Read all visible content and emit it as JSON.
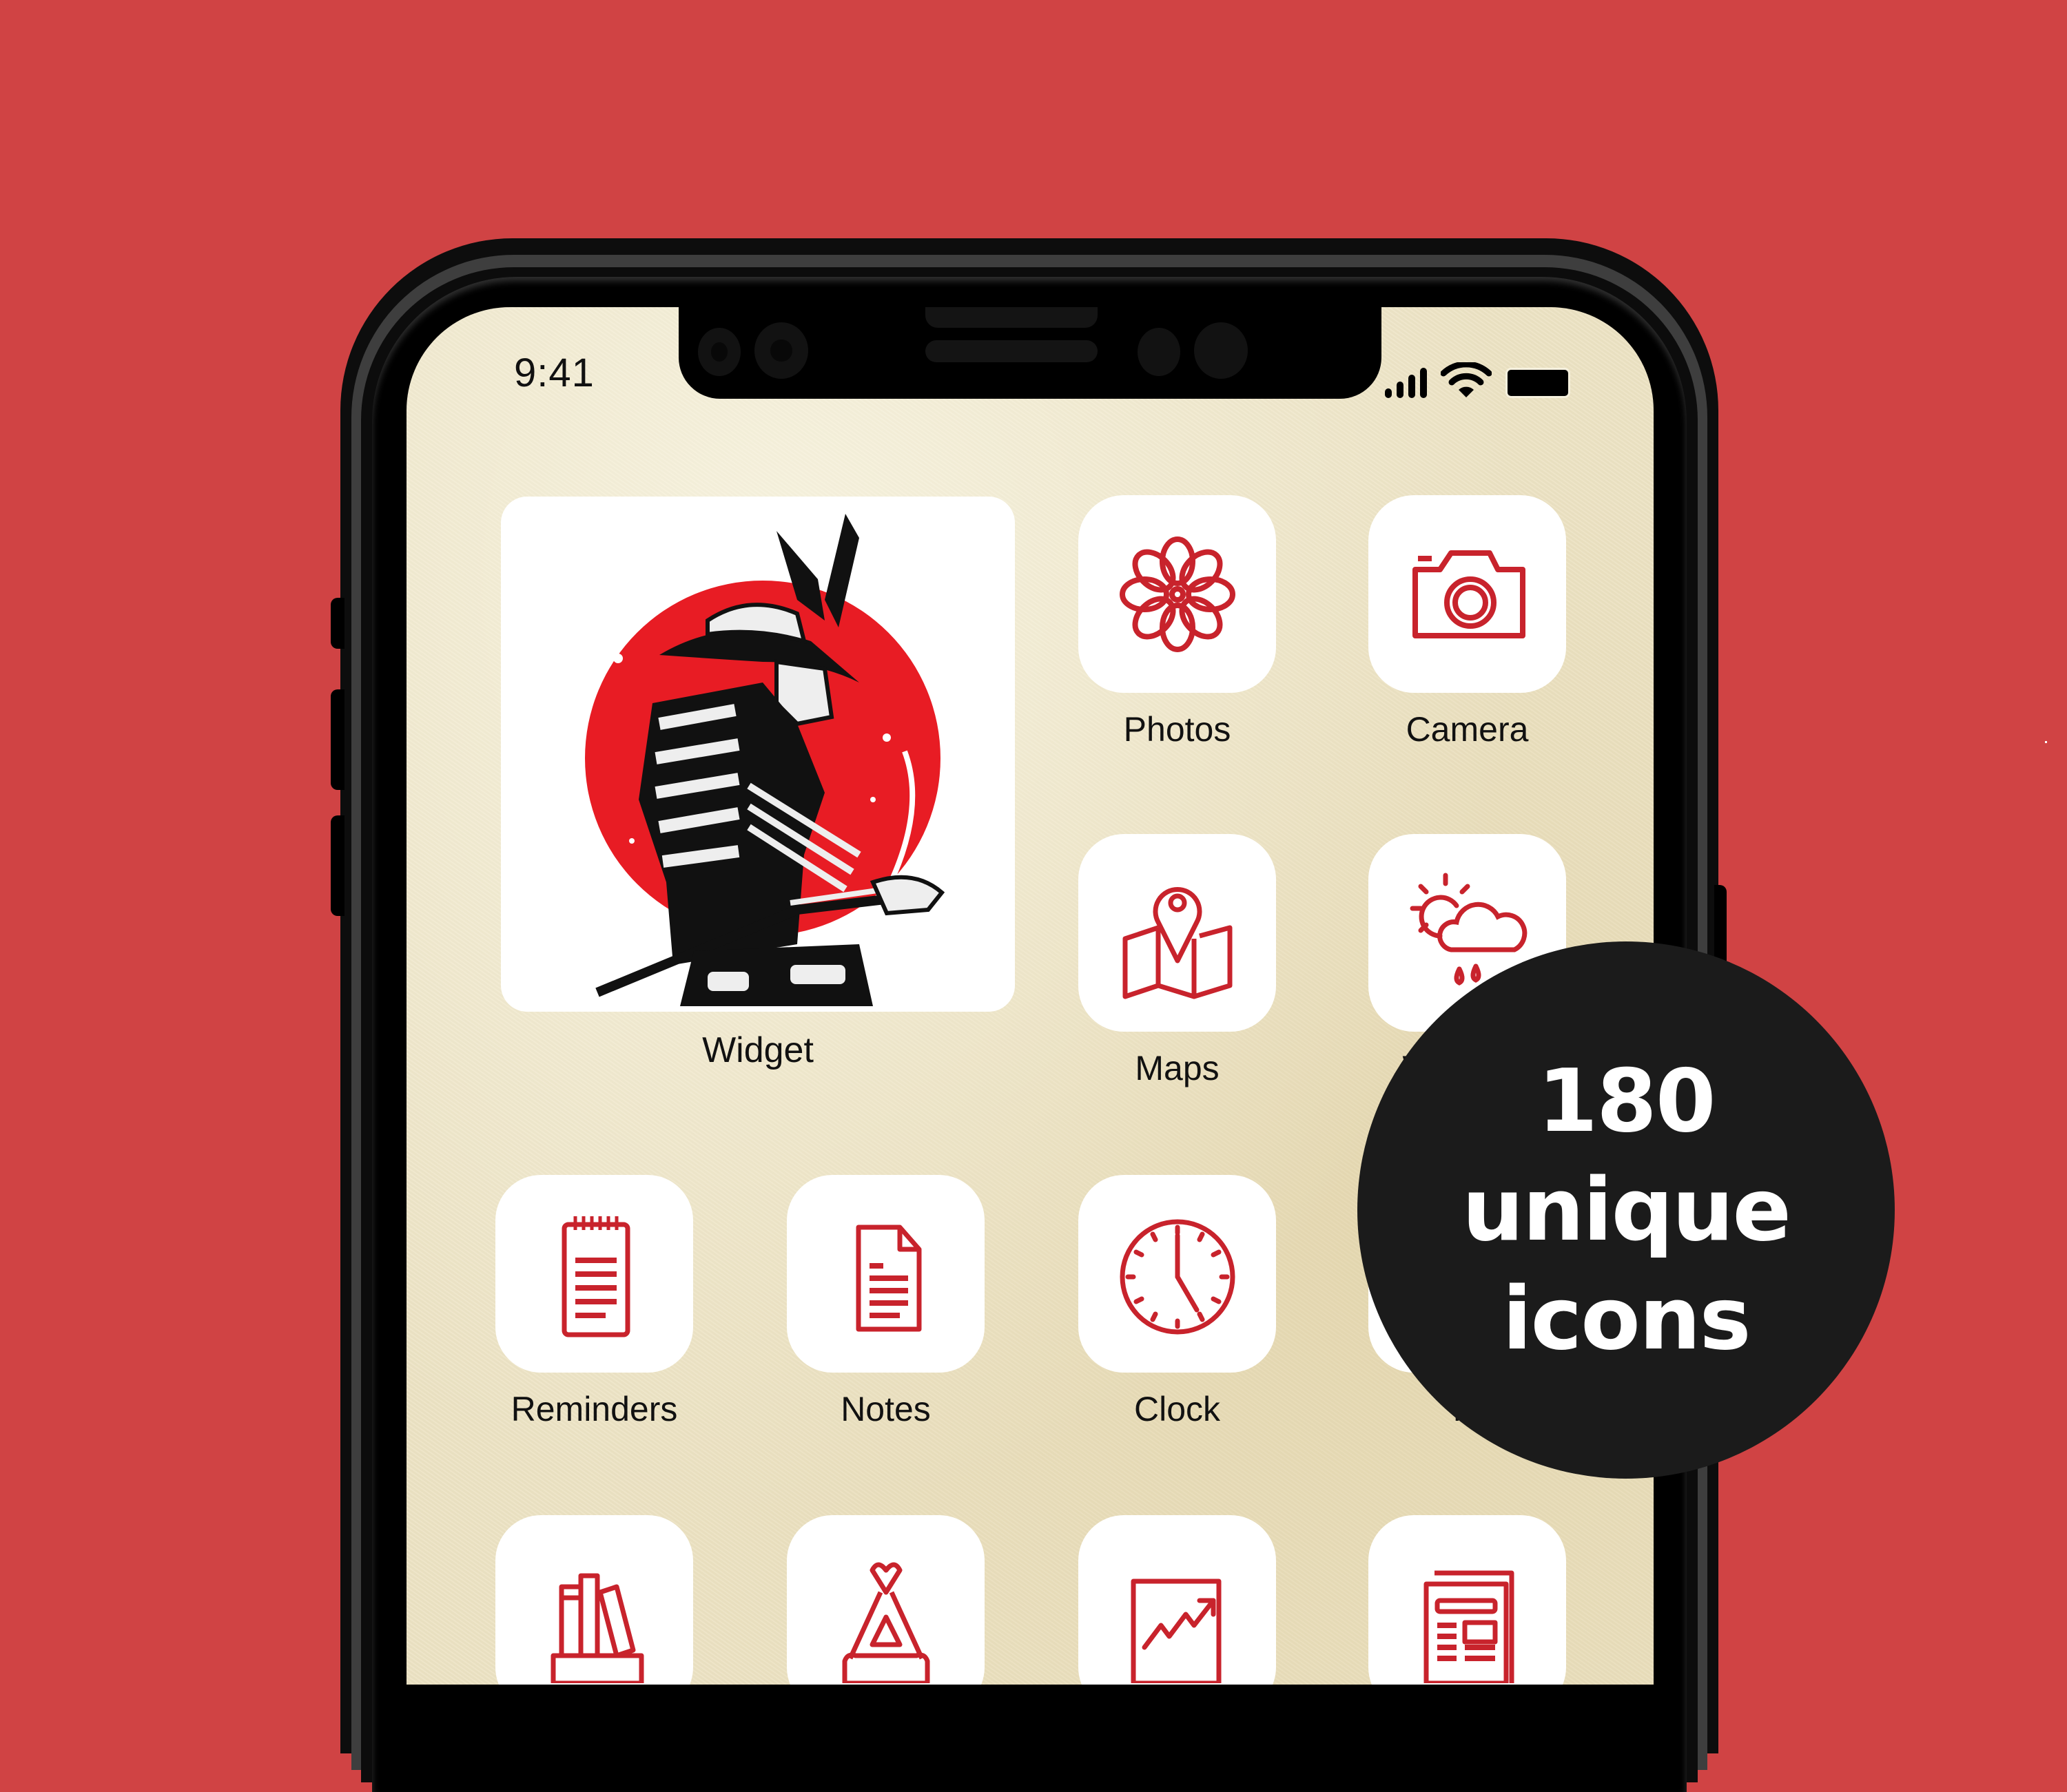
{
  "background_color": "#d04344",
  "accent_color": "#c8232c",
  "status_bar": {
    "time": "9:41",
    "icons": [
      "cellular-signal-icon",
      "wifi-icon",
      "battery-icon"
    ]
  },
  "widget": {
    "label": "Widget",
    "image": "samurai-red-sun-illustration"
  },
  "apps": [
    {
      "label": "Photos",
      "icon": "flower-icon"
    },
    {
      "label": "Camera",
      "icon": "camera-icon"
    },
    {
      "label": "Maps",
      "icon": "map-pin-icon"
    },
    {
      "label": "Weather",
      "icon": "sun-cloud-rain-icon",
      "visible_label": "W"
    },
    {
      "label": "Reminders",
      "icon": "notepad-icon"
    },
    {
      "label": "Notes",
      "icon": "document-icon"
    },
    {
      "label": "Clock",
      "icon": "clock-icon"
    },
    {
      "label": "M",
      "icon": "hidden-icon"
    },
    {
      "label": "",
      "icon": "bookshelf-icon"
    },
    {
      "label": "",
      "icon": "tent-icon"
    },
    {
      "label": "",
      "icon": "stocks-chart-icon"
    },
    {
      "label": "",
      "icon": "newspaper-icon"
    }
  ],
  "badge": {
    "line1": "180",
    "line2": "unique",
    "line3": "icons"
  }
}
